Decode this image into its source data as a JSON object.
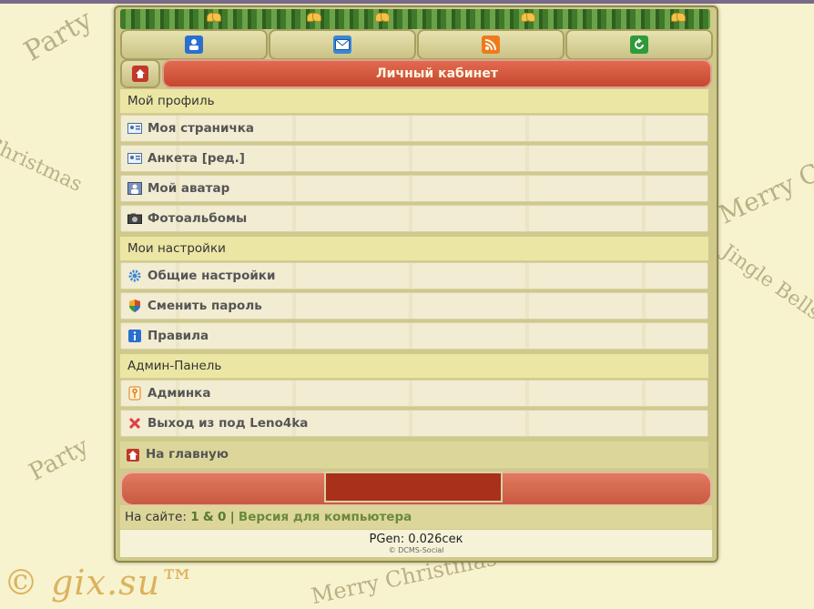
{
  "background": {
    "doodles": [
      "Party",
      "Merry Christmas",
      "Jingle Bells",
      "Merry Christmas",
      "Christmas",
      "Party"
    ],
    "watermark": "© gix.su™"
  },
  "topbar": {
    "buttons": [
      {
        "icon": "user-icon",
        "color": "#2a6fd0"
      },
      {
        "icon": "mail-icon",
        "color": "#3a86d8"
      },
      {
        "icon": "rss-icon",
        "color": "#f07a1a"
      },
      {
        "icon": "refresh-icon",
        "color": "#2f9a3a"
      }
    ]
  },
  "header": {
    "title": "Личный кабинет"
  },
  "sections": [
    {
      "title": "Мой профиль",
      "items": [
        {
          "label": "Моя страничка",
          "icon": "id-card-icon"
        },
        {
          "label": "Анкета [ред.]",
          "icon": "id-card-icon"
        },
        {
          "label": "Мой аватар",
          "icon": "avatar-icon"
        },
        {
          "label": "Фотоальбомы",
          "icon": "camera-icon"
        }
      ]
    },
    {
      "title": "Мои настройки",
      "items": [
        {
          "label": "Общие настройки",
          "icon": "gear-icon"
        },
        {
          "label": "Сменить пароль",
          "icon": "shield-icon"
        },
        {
          "label": "Правила",
          "icon": "info-icon"
        }
      ]
    },
    {
      "title": "Админ-Панель",
      "items": [
        {
          "label": "Админка",
          "icon": "key-icon"
        },
        {
          "label": "Выход из под Leno4ka",
          "icon": "close-icon"
        }
      ]
    }
  ],
  "home": {
    "label": "На главную",
    "icon": "home-icon"
  },
  "online": {
    "prefix": "На сайте:",
    "count1": "1",
    "amp": "&",
    "count2": "0",
    "sep": "|",
    "desktop": "Версия для компьютера"
  },
  "footer": {
    "pgen": "PGen: 0.026сек",
    "copyright": "© DCMS-Social"
  }
}
